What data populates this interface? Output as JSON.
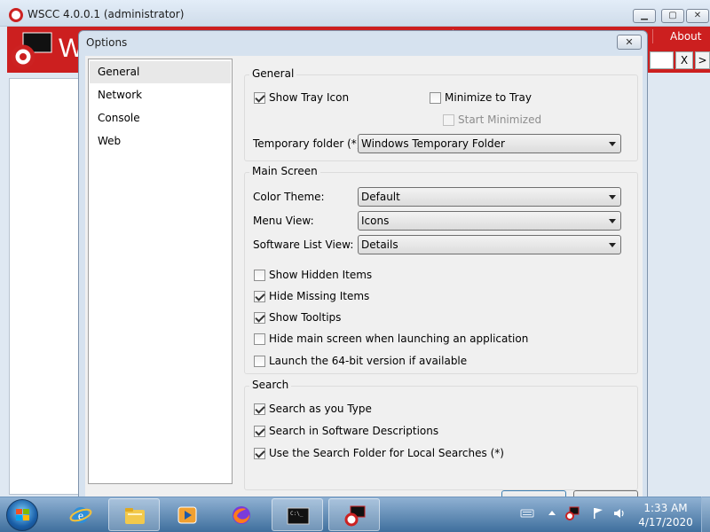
{
  "main_window": {
    "title": "WSCC 4.0.0.1 (administrator)",
    "header_logo_text": "W",
    "about_label": "About",
    "search_clear_label": "X",
    "search_next_label": ">"
  },
  "dialog": {
    "title": "Options",
    "close_glyph": "✕",
    "nav": [
      "General",
      "Network",
      "Console",
      "Web"
    ],
    "general": {
      "legend": "General",
      "show_tray_icon": "Show Tray Icon",
      "minimize_to_tray": "Minimize to Tray",
      "start_minimized": "Start Minimized",
      "temp_folder_label": "Temporary folder (*):",
      "temp_folder_value": "Windows Temporary Folder"
    },
    "main_screen": {
      "legend": "Main Screen",
      "color_theme_label": "Color Theme:",
      "color_theme_value": "Default",
      "menu_view_label": "Menu View:",
      "menu_view_value": "Icons",
      "software_list_view_label": "Software List View:",
      "software_list_view_value": "Details",
      "show_hidden_items": "Show Hidden Items",
      "hide_missing_items": "Hide Missing Items",
      "show_tooltips": "Show Tooltips",
      "hide_main_screen": "Hide main screen when launching an application",
      "launch_64bit": "Launch the 64-bit version if available"
    },
    "search": {
      "legend": "Search",
      "search_as_you_type": "Search as you Type",
      "search_descriptions": "Search in Software Descriptions",
      "use_search_folder": "Use the Search Folder for Local Searches (*)"
    }
  },
  "taskbar": {
    "time": "1:33 AM",
    "date": "4/17/2020"
  },
  "colors": {
    "header_red": "#cc1f1f",
    "taskbar_blue": "#3f6f9d"
  }
}
